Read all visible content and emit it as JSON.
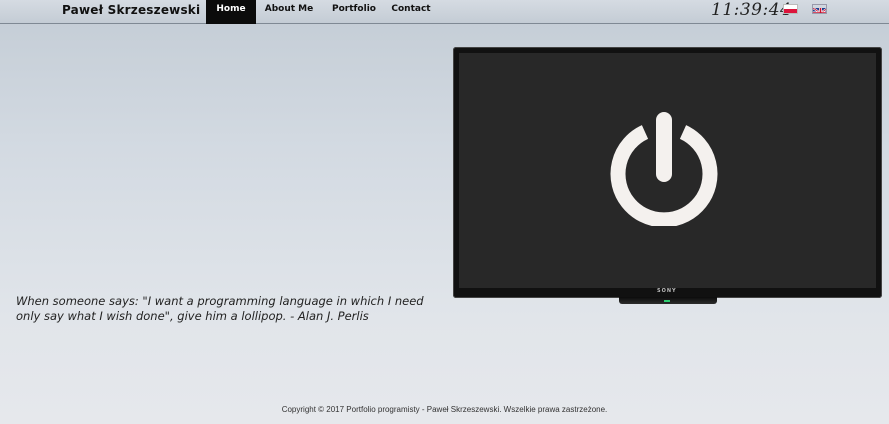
{
  "header": {
    "brand": "Paweł Skrzeszewski",
    "nav": [
      {
        "label": "Home"
      },
      {
        "label": "About Me"
      },
      {
        "label": "Portfolio"
      },
      {
        "label": "Contact"
      }
    ],
    "clock": "11:39:44",
    "languages": [
      {
        "code": "pl",
        "icon": "poland-flag-icon"
      },
      {
        "code": "en",
        "icon": "uk-flag-icon"
      }
    ]
  },
  "hero": {
    "tv_brand": "SONY",
    "power_icon": "power-icon",
    "quote": "When someone says: \"I want a programming language in which I need only say what I wish done\", give him a lollipop. - Alan J. Perlis"
  },
  "footer": {
    "copyright": "Copyright © 2017 Portfolio programisty - Paweł Skrzeszewski. Wszelkie prawa zastrzeżone."
  },
  "colors": {
    "nav_active_bg": "#0b0b0b",
    "tv_screen": "#282828",
    "power_symbol": "#f4f1ee"
  }
}
